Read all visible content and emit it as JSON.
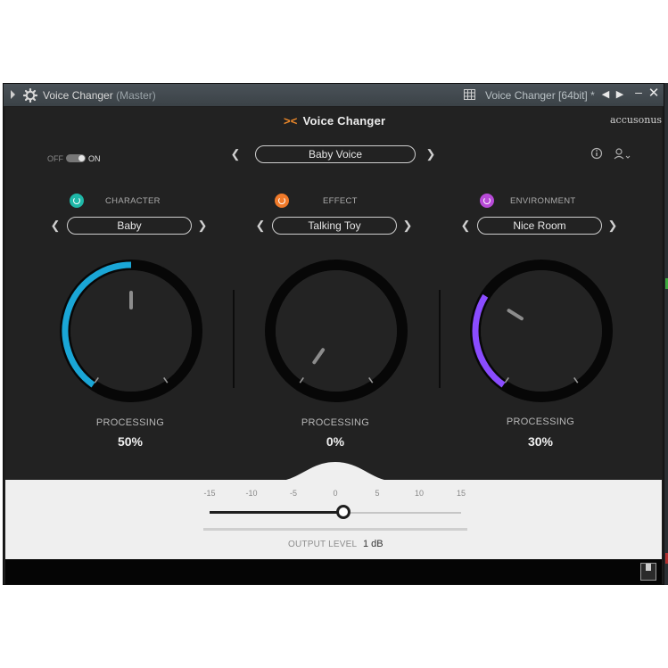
{
  "window": {
    "title": "Voice Changer",
    "title_sub": "(Master)",
    "preset_title": "Voice Changer [64bit] *"
  },
  "plugin": {
    "brand": "Voice Changer",
    "vendor": "accusonus",
    "power": {
      "off_label": "OFF",
      "on_label": "ON",
      "state": "on"
    },
    "preset": "Baby Voice"
  },
  "modules": [
    {
      "label": "CHARACTER",
      "selection": "Baby",
      "processing_label": "PROCESSING",
      "processing_value": "50%",
      "processing_fraction": 0.5,
      "color": "#1aa6d6",
      "power_color": "#1fb8a8"
    },
    {
      "label": "EFFECT",
      "selection": "Talking Toy",
      "processing_label": "PROCESSING",
      "processing_value": "0%",
      "processing_fraction": 0.0,
      "color": "#f07a2a",
      "power_color": "#f07a2a"
    },
    {
      "label": "ENVIRONMENT",
      "selection": "Nice Room",
      "processing_label": "PROCESSING",
      "processing_value": "30%",
      "processing_fraction": 0.3,
      "color": "#8a4cff",
      "power_color": "#b84bd8"
    }
  ],
  "output": {
    "label": "OUTPUT LEVEL",
    "value": "1 dB",
    "value_db": 1,
    "scale": [
      "-15",
      "-10",
      "-5",
      "0",
      "5",
      "10",
      "15"
    ],
    "range_db": [
      -15,
      15
    ]
  },
  "icons": {
    "gear": "gear-icon",
    "info": "info-icon",
    "user": "user-icon",
    "prev": "chevron-left-icon",
    "next": "chevron-right-icon",
    "minimize": "minimize-icon",
    "close": "close-icon",
    "grid": "grid-icon",
    "resize": "resize-icon"
  }
}
